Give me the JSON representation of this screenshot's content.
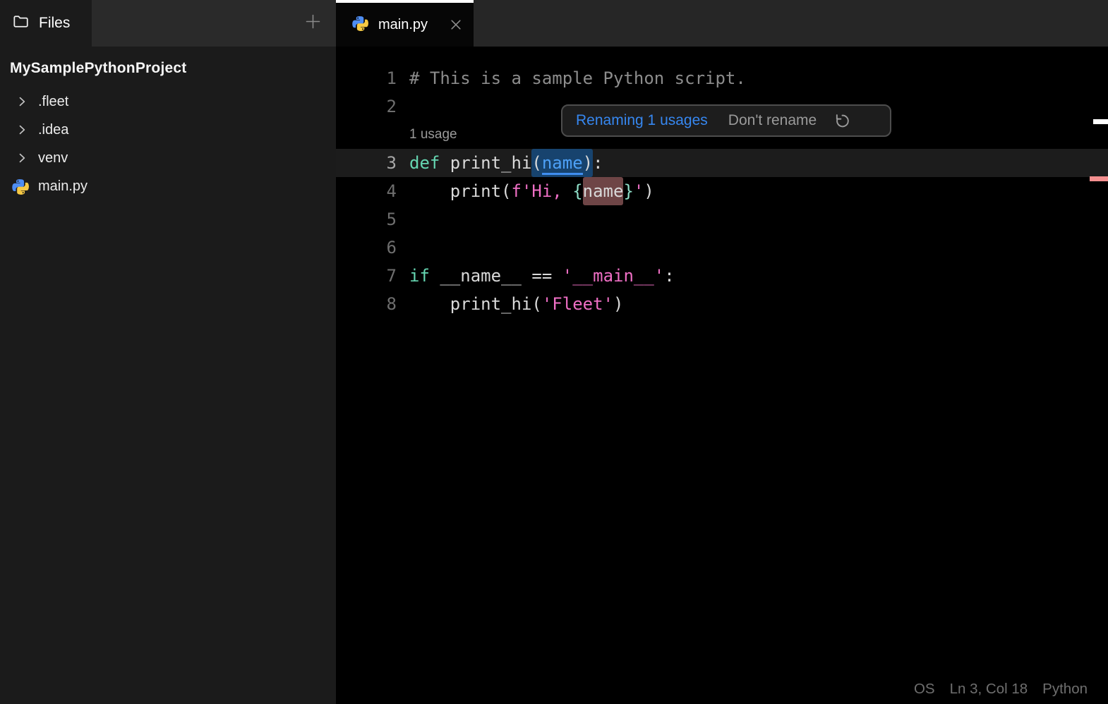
{
  "sidebar": {
    "panel_title": "Files",
    "add_button_icon": "plus-icon",
    "panel_icon": "folder-icon",
    "project_name": "MySamplePythonProject",
    "items": [
      {
        "label": ".fleet",
        "kind": "folder",
        "icon": "chevron-right-icon"
      },
      {
        "label": ".idea",
        "kind": "folder",
        "icon": "chevron-right-icon"
      },
      {
        "label": "venv",
        "kind": "folder",
        "icon": "chevron-right-icon"
      },
      {
        "label": "main.py",
        "kind": "python-file",
        "icon": "python-icon"
      }
    ]
  },
  "tabbar": {
    "tabs": [
      {
        "label": "main.py",
        "active": true,
        "icon": "python-icon",
        "close_icon": "close-icon"
      }
    ]
  },
  "editor": {
    "rows": [
      {
        "num": "1",
        "tokens": [
          {
            "t": "# This is a sample Python script.",
            "c": "comment"
          }
        ]
      },
      {
        "num": "2",
        "tokens": []
      },
      {
        "hint": "1 usage"
      },
      {
        "num": "3",
        "current": true,
        "tokens": [
          {
            "t": "def",
            "c": "kw"
          },
          {
            "t": " print_hi",
            "c": "d"
          },
          {
            "box": "blue",
            "tokens": [
              {
                "t": "(",
                "c": "d"
              },
              {
                "t": "name",
                "c": "param"
              },
              {
                "t": ")",
                "c": "d"
              }
            ]
          },
          {
            "t": ":",
            "c": "d"
          }
        ]
      },
      {
        "num": "4",
        "tokens": [
          {
            "t": "    print(",
            "c": "d"
          },
          {
            "t": "f",
            "c": "str"
          },
          {
            "t": "'Hi, ",
            "c": "str"
          },
          {
            "t": "{",
            "c": "brace"
          },
          {
            "box": "maroon",
            "tokens": [
              {
                "t": "name",
                "c": "d"
              }
            ]
          },
          {
            "t": "}",
            "c": "brace"
          },
          {
            "t": "'",
            "c": "str"
          },
          {
            "t": ")",
            "c": "d"
          }
        ]
      },
      {
        "num": "5",
        "tokens": []
      },
      {
        "num": "6",
        "tokens": []
      },
      {
        "num": "7",
        "tokens": [
          {
            "t": "if",
            "c": "kw"
          },
          {
            "t": " __name__ ",
            "c": "d"
          },
          {
            "t": "== ",
            "c": "d"
          },
          {
            "t": "'__main__'",
            "c": "str"
          },
          {
            "t": ":",
            "c": "d"
          }
        ]
      },
      {
        "num": "8",
        "tokens": [
          {
            "t": "    print_hi(",
            "c": "d"
          },
          {
            "t": "'Fleet'",
            "c": "str"
          },
          {
            "t": ")",
            "c": "d"
          }
        ]
      }
    ]
  },
  "popup": {
    "rename_label": "Renaming 1 usages",
    "dont_rename_label": "Don't rename",
    "revert_icon": "revert-icon"
  },
  "status_bar": {
    "os": "OS",
    "caret_position": "Ln 3, Col 18",
    "language": "Python"
  },
  "colors": {
    "editor_bg": "#000000",
    "sidebar_bg": "#1b1b1b",
    "header_bg": "#2a2a2a",
    "tab_strip_bg": "#262626",
    "current_line_bg": "#1c1c1c",
    "accent_blue": "#3687f0",
    "param_blue": "#4da0f6",
    "rename_box_bg": "#17436e",
    "usage_box_bg": "#6e4546",
    "keyword_teal": "#66d6b2",
    "string_pink": "#ef6fc5",
    "comment_gray": "#8c8c8c",
    "change_marker_salmon": "#f49090",
    "caret_marker_white": "#ffffff",
    "python_blue": "#4e8df2",
    "python_yellow": "#f6c944"
  }
}
